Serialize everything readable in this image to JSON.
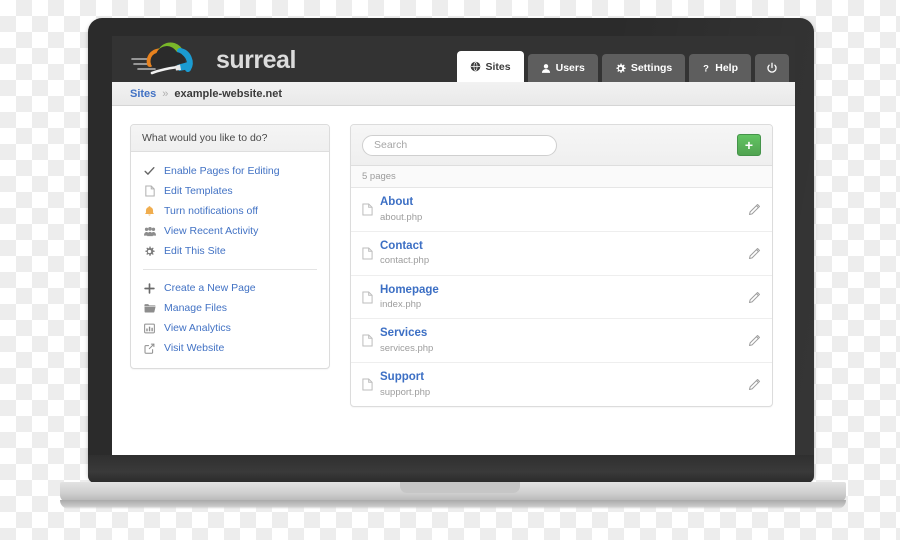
{
  "app": {
    "brand_name": "surreal",
    "logo_icon": "cloud-paintbrush-logo",
    "header_bg": "#333333",
    "accent_blue": "#4272c4",
    "accent_green": "#51a351",
    "warning_orange": "#f0ad4e"
  },
  "nav": {
    "tabs": [
      {
        "label": "Sites",
        "icon": "globe-icon",
        "active": true
      },
      {
        "label": "Users",
        "icon": "user-icon",
        "active": false
      },
      {
        "label": "Settings",
        "icon": "gear-icon",
        "active": false
      },
      {
        "label": "Help",
        "icon": "question-mark-icon",
        "active": false
      }
    ],
    "power_button": {
      "label": "",
      "icon": "power-icon"
    }
  },
  "breadcrumb": {
    "root": "Sites",
    "separator": "»",
    "current": "example-website.net"
  },
  "sidebar": {
    "heading": "What would you like to do?",
    "group_one": [
      {
        "label": "Enable Pages for Editing",
        "icon": "check-icon"
      },
      {
        "label": "Edit Templates",
        "icon": "document-icon"
      },
      {
        "label": "Turn notifications off",
        "icon": "bell-icon"
      },
      {
        "label": "View Recent Activity",
        "icon": "users-group-icon"
      },
      {
        "label": "Edit This Site",
        "icon": "gear-icon"
      }
    ],
    "group_two": [
      {
        "label": "Create a New Page",
        "icon": "plus-icon"
      },
      {
        "label": "Manage Files",
        "icon": "folder-icon"
      },
      {
        "label": "View Analytics",
        "icon": "chart-icon"
      },
      {
        "label": "Visit Website",
        "icon": "external-link-icon"
      }
    ]
  },
  "pages_panel": {
    "search": {
      "value": "",
      "placeholder": "Search",
      "icon": "search-field"
    },
    "add_button": {
      "label": "+",
      "icon": "plus-icon"
    },
    "count_label": "5 pages",
    "rows": [
      {
        "title": "About",
        "file": "about.php",
        "icon": "file-icon",
        "action_icon": "pencil-icon"
      },
      {
        "title": "Contact",
        "file": "contact.php",
        "icon": "file-icon",
        "action_icon": "pencil-icon"
      },
      {
        "title": "Homepage",
        "file": "index.php",
        "icon": "file-icon",
        "action_icon": "pencil-icon"
      },
      {
        "title": "Services",
        "file": "services.php",
        "icon": "file-icon",
        "action_icon": "pencil-icon"
      },
      {
        "title": "Support",
        "file": "support.php",
        "icon": "file-icon",
        "action_icon": "pencil-icon"
      }
    ]
  }
}
